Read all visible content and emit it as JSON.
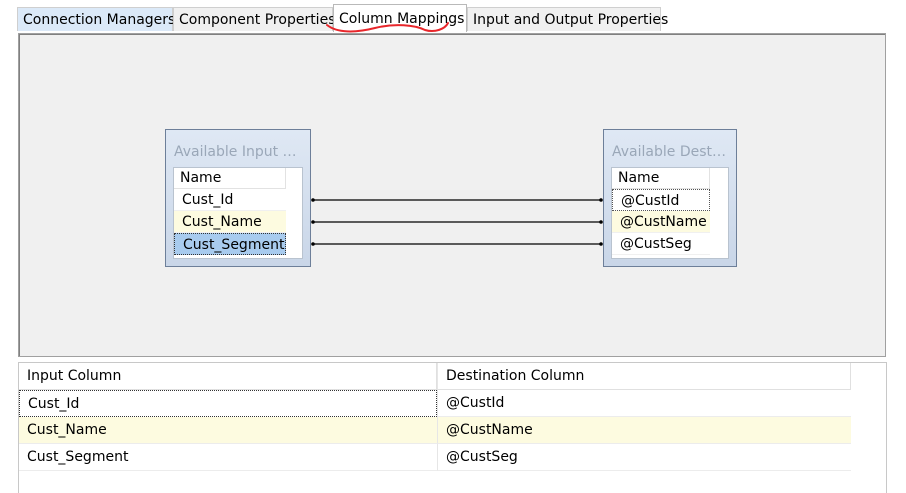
{
  "tabs": [
    {
      "label": "Connection Managers"
    },
    {
      "label": "Component Properties"
    },
    {
      "label": "Column Mappings"
    },
    {
      "label": "Input and Output Properties"
    }
  ],
  "active_tab": "Column Mappings",
  "colors": {
    "annotation": "#e8262b",
    "link_line": "#000000",
    "highlight_row": "#fdfbe0",
    "selected_row": "#a8cbee"
  },
  "input_box": {
    "title": "Available Input C...",
    "header": "Name",
    "columns": [
      "Cust_Id",
      "Cust_Name",
      "Cust_Segment"
    ]
  },
  "dest_box": {
    "title": "Available Desti...",
    "header": "Name",
    "columns": [
      "@CustId",
      "@CustName",
      "@CustSeg"
    ]
  },
  "grid": {
    "headers": [
      "Input Column",
      "Destination Column"
    ],
    "rows": [
      [
        "Cust_Id",
        "@CustId"
      ],
      [
        "Cust_Name",
        "@CustName"
      ],
      [
        "Cust_Segment",
        "@CustSeg"
      ]
    ]
  }
}
